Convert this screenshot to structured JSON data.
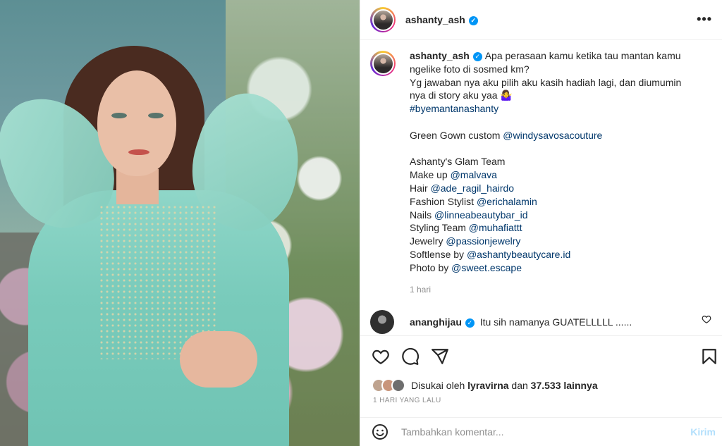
{
  "post": {
    "username": "ashanty_ash",
    "more_icon": "more-horizontal-icon",
    "verified_icon": "verified-badge-icon"
  },
  "caption": {
    "username": "ashanty_ash",
    "lines": [
      "Apa perasaan kamu ketika tau mantan kamu",
      "ngelike foto di sosmed km?",
      "Yg jawaban nya aku pilih aku kasih hadiah lagi, dan diumumin",
      "nya di story aku yaa 🤷‍♀️"
    ],
    "hashtag": "#byemantanashanty",
    "gown_prefix": "Green Gown custom ",
    "gown_link": "@windysavosacouture",
    "team_title": "Ashanty's Glam Team",
    "credits": [
      {
        "role": "Make up ",
        "handle": "@malvava"
      },
      {
        "role": "Hair ",
        "handle": "@ade_ragil_hairdo"
      },
      {
        "role": "Fashion Stylist ",
        "handle": "@erichalamin"
      },
      {
        "role": "Nails ",
        "handle": "@linneabeautybar_id"
      },
      {
        "role": "Styling Team ",
        "handle": "@muhafiattt"
      },
      {
        "role": "Jewelry ",
        "handle": "@passionjewelry"
      },
      {
        "role": "Softlense by ",
        "handle": "@ashantybeautycare.id"
      },
      {
        "role": "Photo by ",
        "handle": "@sweet.escape"
      }
    ],
    "time": "1 hari"
  },
  "comment": {
    "username": "ananghijau",
    "text": "Itu sih namanya GUATELLLLL ......"
  },
  "actions": {
    "icons": [
      "heart-icon",
      "comment-icon",
      "share-icon",
      "bookmark-icon"
    ],
    "likes_prefix": "Disukai oleh ",
    "liked_by": "lyravirna",
    "likes_mid": " dan ",
    "likes_count": "37.533 lainnya",
    "date": "1 HARI YANG LALU"
  },
  "add_comment": {
    "placeholder": "Tambahkan komentar...",
    "post_label": "Kirim",
    "emoji_icon": "emoji-icon"
  },
  "colors": {
    "link": "#00376b",
    "verified": "#0095f6",
    "post_disabled": "#b2dffc"
  }
}
